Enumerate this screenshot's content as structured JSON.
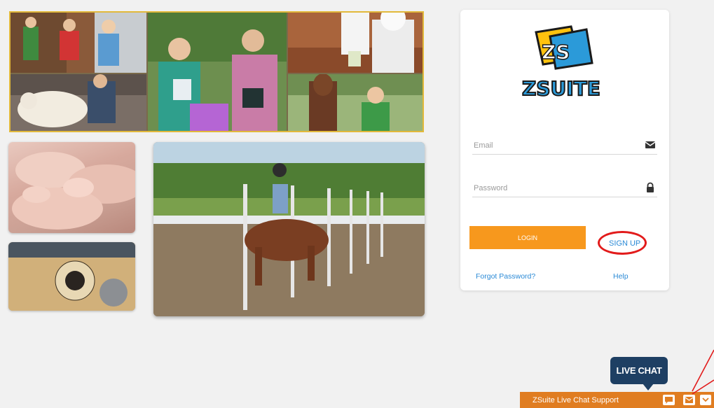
{
  "brand": {
    "logo_text": "ZSUITE",
    "logo_mark": "ZS"
  },
  "login": {
    "email_placeholder": "Email",
    "password_placeholder": "Password",
    "login_label": "LOGIN",
    "signup_label": "SIGN UP",
    "forgot_label": "Forgot Password?",
    "help_label": "Help"
  },
  "live_chat": {
    "bubble_label": "LIVE CHAT",
    "bar_title": "ZSuite Live Chat Support",
    "icons": [
      "chat-icon",
      "envelope-icon",
      "chevron-down-icon"
    ]
  },
  "colors": {
    "accent_orange": "#f7981d",
    "link_blue": "#2b8ad6",
    "annotation_red": "#e21b1b",
    "chat_navy": "#1e3f63",
    "chat_bar": "#e07d21"
  }
}
